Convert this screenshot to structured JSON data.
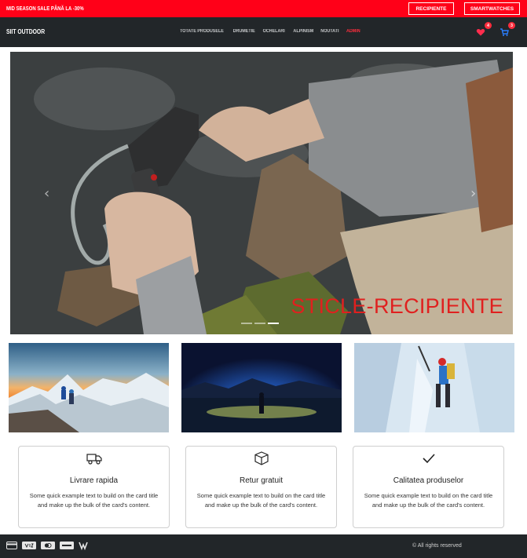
{
  "promo": {
    "text": "MID SEASON SALE PÂNĂ LA -30%",
    "button_1": "RECIPIENTE",
    "button_2": "SMARTWATCHES"
  },
  "navbar": {
    "brand": "SIIT OUTDOOR",
    "menu": [
      "TOTATE PRODUSELE",
      "DRUMETIE",
      "OCHELARI",
      "ALPINISM",
      "NOUTATI",
      "ADMIN"
    ],
    "wishlist_count": "4",
    "cart_count": "3"
  },
  "carousel": {
    "caption": "STICLE-RECIPIENTE",
    "slides": 3,
    "active_slide": 3
  },
  "thumbnails": [
    "mountain-climbers-sunset",
    "person-headlamp-night",
    "ice-climber"
  ],
  "features": [
    {
      "icon": "truck-icon",
      "title": "Livrare rapida",
      "text": "Some quick example text to build on the card title and make up the bulk of the card's content."
    },
    {
      "icon": "box-icon",
      "title": "Retur gratuit",
      "text": "Some quick example text to build on the card title and make up the bulk of the card's content."
    },
    {
      "icon": "check-icon",
      "title": "Calitatea produselor",
      "text": "Some quick example text to build on the card title and make up the bulk of the card's content."
    }
  ],
  "footer": {
    "payment_icons": [
      "credit-card-icon",
      "visa-icon",
      "mastercard-icon",
      "paypal-icon",
      "wise-icon"
    ],
    "copyright": "© All rights reserved"
  },
  "colors": {
    "promo_bg": "#ff0018",
    "nav_bg": "#222629",
    "accent_red": "#e0201f"
  }
}
